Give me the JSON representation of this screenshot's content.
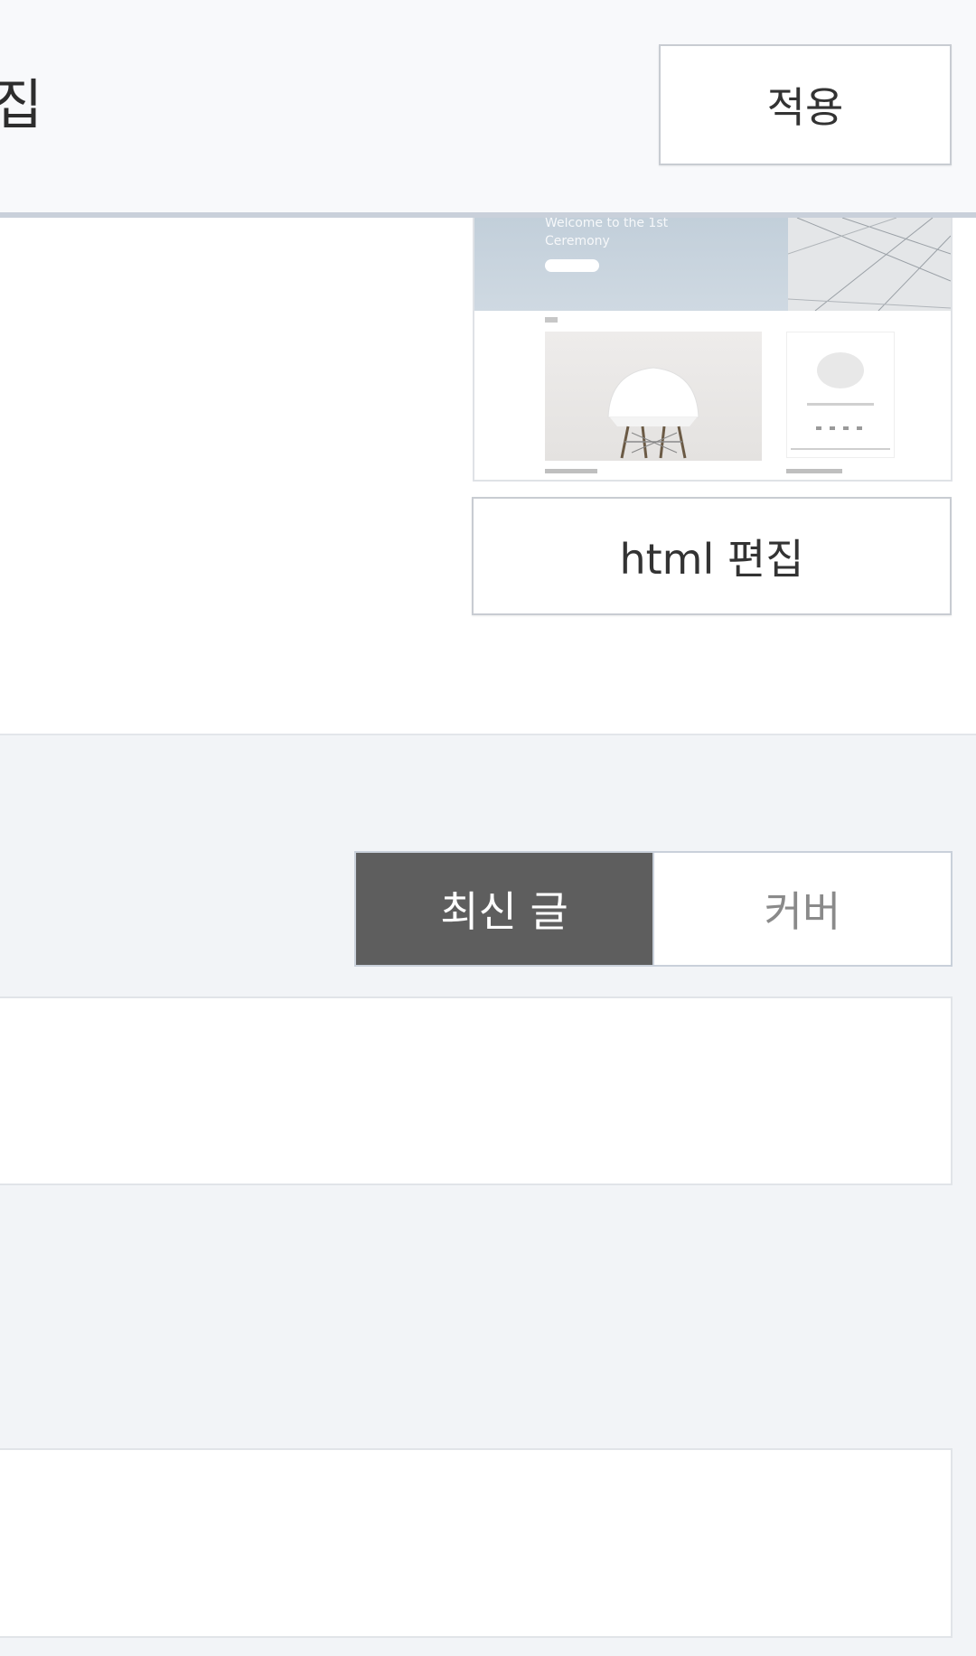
{
  "header": {
    "title_partial": "집",
    "apply_label": "적용"
  },
  "skin": {
    "thumbnail_title": "Welcome to the 1st\nCeremony",
    "html_edit_label": "html 편집"
  },
  "home_tabs": {
    "options": [
      "최신 글",
      "커버"
    ],
    "selected": "최신 글"
  },
  "colors": {
    "active_toggle": "#5e5e5e",
    "page_bg": "#f2f4f7",
    "header_divider": "#c9d0da"
  },
  "icons": []
}
